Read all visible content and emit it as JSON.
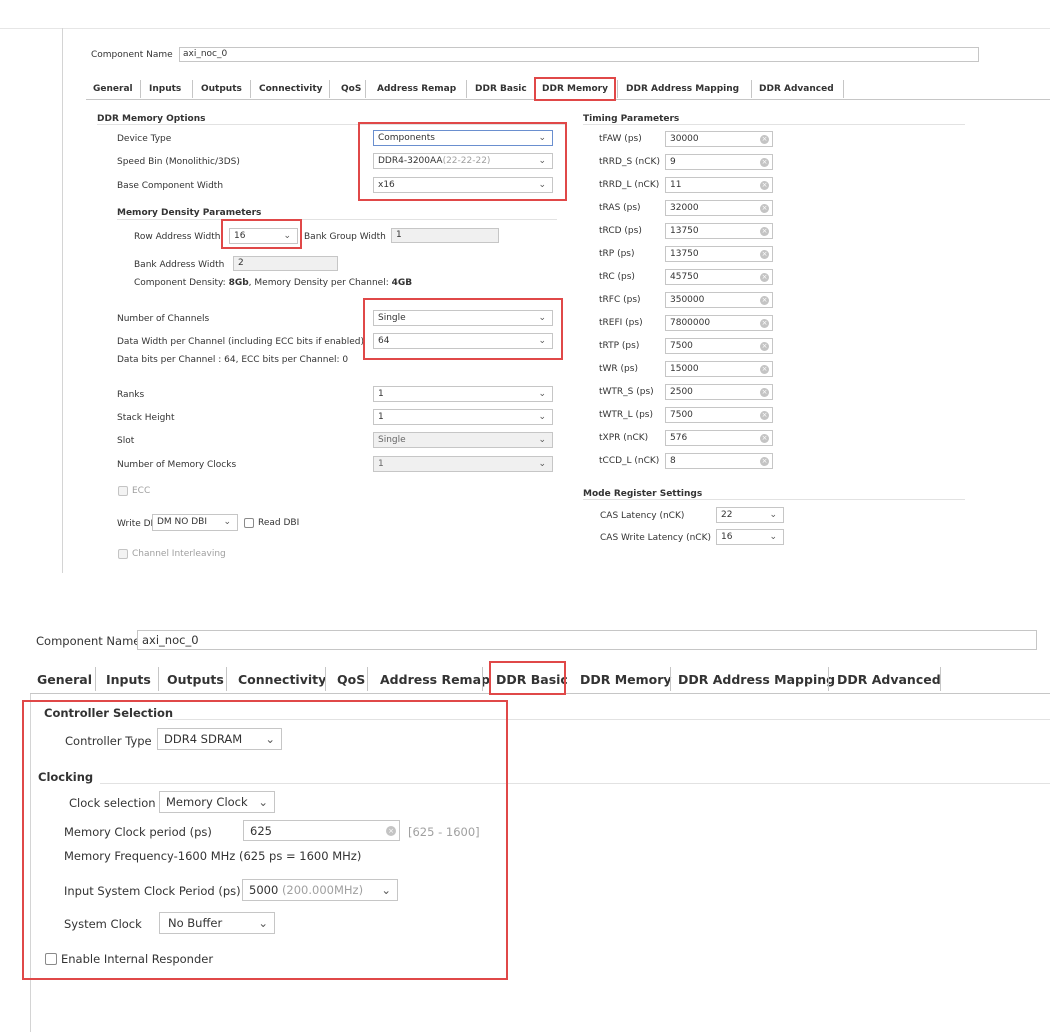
{
  "top": {
    "component_name_label": "Component Name",
    "component_name_value": "axi_noc_0",
    "tabs": [
      "General",
      "Inputs",
      "Outputs",
      "Connectivity",
      "QoS",
      "Address Remap",
      "DDR Basic",
      "DDR Memory",
      "DDR Address Mapping",
      "DDR Advanced"
    ],
    "active_tab": "DDR Memory",
    "ddr_memory_options": {
      "title": "DDR Memory Options",
      "device_type_label": "Device Type",
      "device_type_value": "Components",
      "speed_bin_label": "Speed Bin (Monolithic/3DS)",
      "speed_bin_value": "DDR4-3200AA",
      "speed_bin_suffix": "(22-22-22)",
      "base_width_label": "Base Component Width",
      "base_width_value": "x16",
      "density_title": "Memory Density Parameters",
      "row_addr_label": "Row Address Width",
      "row_addr_value": "16",
      "bank_group_label": "Bank Group Width",
      "bank_group_value": "1",
      "bank_addr_label": "Bank Address Width",
      "bank_addr_value": "2",
      "density_prefix": "Component Density: ",
      "density_value": "8Gb",
      "density_mid": ", Memory Density per Channel: ",
      "density_channel_value": "4GB",
      "channels_label": "Number of Channels",
      "channels_value": "Single",
      "data_width_label": "Data Width per Channel (including ECC bits if enabled)",
      "data_width_value": "64",
      "data_bits_text": "Data bits per Channel : 64, ECC bits per Channel: 0",
      "ranks_label": "Ranks",
      "ranks_value": "1",
      "stack_label": "Stack Height",
      "stack_value": "1",
      "slot_label": "Slot",
      "slot_value": "Single",
      "mem_clocks_label": "Number of Memory Clocks",
      "mem_clocks_value": "1",
      "ecc_label": "ECC",
      "write_dbi_label": "Write DBI",
      "write_dbi_value": "DM NO DBI",
      "read_dbi_label": "Read DBI",
      "interleave_label": "Channel Interleaving"
    },
    "timing": {
      "title": "Timing Parameters",
      "rows": [
        {
          "label": "tFAW (ps)",
          "value": "30000"
        },
        {
          "label": "tRRD_S (nCK)",
          "value": "9"
        },
        {
          "label": "tRRD_L (nCK)",
          "value": "11"
        },
        {
          "label": "tRAS (ps)",
          "value": "32000"
        },
        {
          "label": "tRCD (ps)",
          "value": "13750"
        },
        {
          "label": "tRP (ps)",
          "value": "13750"
        },
        {
          "label": "tRC (ps)",
          "value": "45750"
        },
        {
          "label": "tRFC (ps)",
          "value": "350000"
        },
        {
          "label": "tREFI (ps)",
          "value": "7800000"
        },
        {
          "label": "tRTP (ps)",
          "value": "7500"
        },
        {
          "label": "tWR (ps)",
          "value": "15000"
        },
        {
          "label": "tWTR_S (ps)",
          "value": "2500"
        },
        {
          "label": "tWTR_L (ps)",
          "value": "7500"
        },
        {
          "label": "tXPR (nCK)",
          "value": "576"
        },
        {
          "label": "tCCD_L (nCK)",
          "value": "8"
        }
      ]
    },
    "mode_register": {
      "title": "Mode Register Settings",
      "cas_label": "CAS Latency (nCK)",
      "cas_value": "22",
      "cas_write_label": "CAS Write Latency (nCK)",
      "cas_write_value": "16"
    }
  },
  "bottom": {
    "component_name_label": "Component Name",
    "component_name_value": "axi_noc_0",
    "tabs": [
      "General",
      "Inputs",
      "Outputs",
      "Connectivity",
      "QoS",
      "Address Remap",
      "DDR Basic",
      "DDR Memory",
      "DDR Address Mapping",
      "DDR Advanced"
    ],
    "active_tab": "DDR Basic",
    "controller_title": "Controller Selection",
    "controller_type_label": "Controller Type",
    "controller_type_value": "DDR4 SDRAM",
    "clocking_title": "Clocking",
    "clock_sel_label": "Clock selection",
    "clock_sel_value": "Memory Clock",
    "mem_period_label": "Memory Clock period (ps)",
    "mem_period_value": "625",
    "mem_period_range": "[625 - 1600]",
    "mem_freq_text": "Memory Frequency-1600 MHz (625 ps = 1600 MHz)",
    "input_period_label": "Input System Clock Period (ps)",
    "input_period_value": "5000",
    "input_period_suffix": "(200.000MHz)",
    "system_clock_label": "System Clock",
    "system_clock_value": "No Buffer",
    "responder_label": "Enable Internal Responder"
  }
}
